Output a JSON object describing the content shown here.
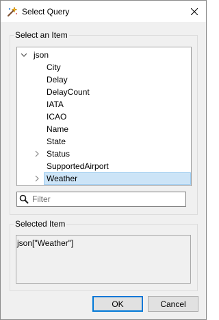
{
  "window": {
    "title": "Select Query"
  },
  "item_group": {
    "label": "Select an Item"
  },
  "tree": {
    "root": {
      "label": "json",
      "expanded": true
    },
    "children": [
      {
        "label": "City",
        "has_children": false,
        "selected": false
      },
      {
        "label": "Delay",
        "has_children": false,
        "selected": false
      },
      {
        "label": "DelayCount",
        "has_children": false,
        "selected": false
      },
      {
        "label": "IATA",
        "has_children": false,
        "selected": false
      },
      {
        "label": "ICAO",
        "has_children": false,
        "selected": false
      },
      {
        "label": "Name",
        "has_children": false,
        "selected": false
      },
      {
        "label": "State",
        "has_children": false,
        "selected": false
      },
      {
        "label": "Status",
        "has_children": true,
        "selected": false
      },
      {
        "label": "SupportedAirport",
        "has_children": false,
        "selected": false
      },
      {
        "label": "Weather",
        "has_children": true,
        "selected": true
      }
    ]
  },
  "filter": {
    "placeholder": "Filter",
    "value": ""
  },
  "selected_group": {
    "label": "Selected Item",
    "value": "json[\"Weather\"]"
  },
  "buttons": {
    "ok": "OK",
    "cancel": "Cancel"
  },
  "colors": {
    "selection_bg": "#cce4f7",
    "selection_border": "#99c9ef",
    "accent": "#0078d7"
  }
}
